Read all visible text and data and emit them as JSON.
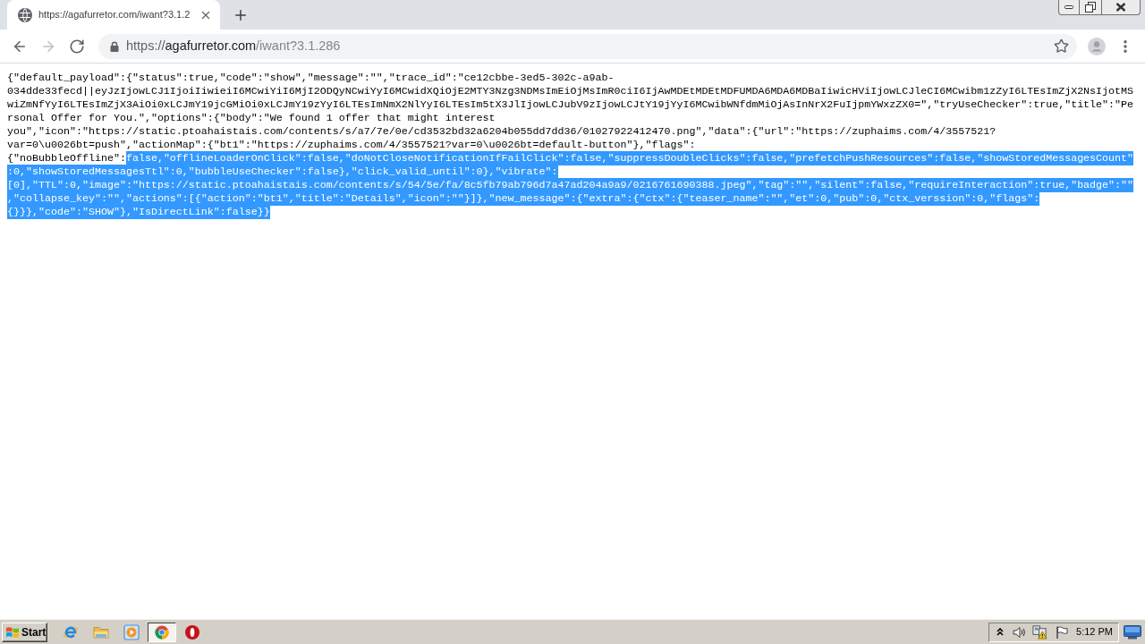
{
  "browser": {
    "tabs": [
      {
        "title": "https://agafurretor.com/iwant?3.1.2",
        "selected": true
      }
    ],
    "nav_buttons": [
      {
        "kind": "back",
        "disabled": false
      },
      {
        "kind": "forward",
        "disabled": true
      },
      {
        "kind": "reload",
        "disabled": false
      }
    ],
    "address_bar": {
      "scheme": "https://",
      "host": "agafurretor.com",
      "path": "/iwant?3.1.286"
    }
  },
  "page": {
    "segments": [
      {
        "text": "{\"default_payload\":{\"status\":true,\"code\":\"show\",\"message\":\"\",\"trace_id\":\"ce12cbbe-3ed5-302c-a9ab-034dde33fecd||eyJzIjowLCJ1IjoiIiwieiI6MCwiYiI6MjI2ODQyNCwiYyI6MCwidXQiOjE2MTY3Nzg3NDMsImEiOjMsImR0ciI6IjAwMDEtMDEtMDFUMDA6MDA6MDBaIiwicHViIjowLCJleCI6MCwibm1zZyI6LTEsImZjX2NsIjotMSwiZmNfYyI6LTEsImZjX3AiOi0xLCJmY19jcGMiOi0xLCJmY19zYyI6LTEsImNmX2NlYyI6LTEsIm5tX3JlIjowLCJubV9zIjowLCJtY19jYyI6MCwibWNfdmMiOjAsInNrX2FuIjpmYWxzZX0=\",\"tryUseChecker\":true,\"title\":\"Personal Offer for You.\",\"options\":{\"body\":\"We found 1 offer that might interest you\",\"icon\":\"https://static.ptoahaistais.com/contents/s/a7/7e/0e/cd3532bd32a6204b055dd7dd36/01027922412470.png\",\"data\":{\"url\":\"https://zuphaims.com/4/3557521?var=0\\u0026bt=push\",\"actionMap\":{\"bt1\":\"https://zuphaims.com/4/3557521?var=0\\u0026bt=default-button\"},\"flags\":{\"noBubbleOffline\":",
        "selected": false
      },
      {
        "text": "false,\"offlineLoaderOnClick\":false,\"doNotCloseNotificationIfFailClick\":false,\"suppressDoubleClicks\":false,\"prefetchPushResources\":false,\"showStoredMessagesCount\":0,\"showStoredMessagesTtl\":0,\"bubbleUseChecker\":false},\"click_valid_until\":0},\"vibrate\":[0],\"TTL\":0,\"image\":\"https://static.ptoahaistais.com/contents/s/54/5e/fa/8c5fb79ab796d7a47ad204a9a9/0216761690388.jpeg\",\"tag\":\"\",\"silent\":false,\"requireInteraction\":true,\"badge\":\"\",\"collapse_key\":\"\",\"actions\":[{\"action\":\"bt1\",\"title\":\"Details\",\"icon\":\"\"}]},\"new_message\":{\"extra\":{\"ctx\":{\"teaser_name\":\"\",\"et\":0,\"pub\":0,\"ctx_verssion\":0,\"flags\":{}}},\"code\":\"SHOW\"},\"IsDirectLink\":false}}",
        "selected": true
      }
    ]
  },
  "taskbar": {
    "start_label": "Start",
    "apps": [
      {
        "kind": "eglobe",
        "selected": false
      },
      {
        "kind": "folder",
        "selected": false
      },
      {
        "kind": "player",
        "selected": false
      },
      {
        "kind": "wheel",
        "selected": true
      },
      {
        "kind": "stop",
        "selected": false
      }
    ],
    "clock": "5:12 PM"
  }
}
